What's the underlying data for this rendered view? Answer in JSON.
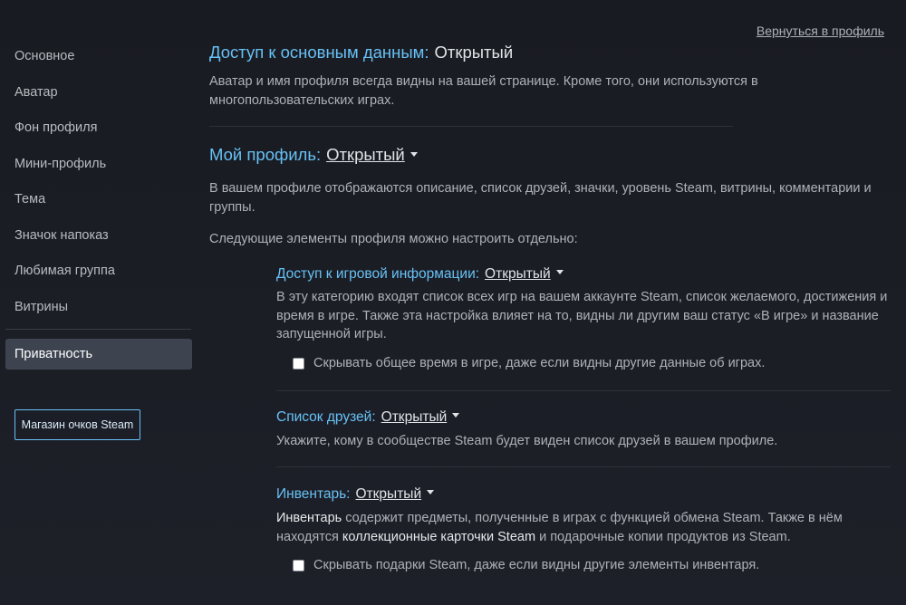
{
  "header": {
    "back_link": "Вернуться в профиль"
  },
  "sidebar": {
    "items": [
      {
        "label": "Основное"
      },
      {
        "label": "Аватар"
      },
      {
        "label": "Фон профиля"
      },
      {
        "label": "Мини-профиль"
      },
      {
        "label": "Тема"
      },
      {
        "label": "Значок напоказ"
      },
      {
        "label": "Любимая группа"
      },
      {
        "label": "Витрины"
      }
    ],
    "active_item": "Приватность",
    "shop_button": "Магазин очков Steam"
  },
  "main": {
    "basic": {
      "title": "Доступ к основным данным:",
      "value": "Открытый",
      "description": "Аватар и имя профиля всегда видны на вашей странице. Кроме того, они используются в многопользовательских играх."
    },
    "profile": {
      "title": "Мой профиль:",
      "value": "Открытый",
      "description": "В вашем профиле отображаются описание, список друзей, значки, уровень Steam, витрины, комментарии и группы.",
      "sub_intro": "Следующие элементы профиля можно настроить отдельно:"
    },
    "game_details": {
      "title": "Доступ к игровой информации:",
      "value": "Открытый",
      "description": "В эту категорию входят список всех игр на вашем аккаунте Steam, список желаемого, достижения и время в игре. Также эта настройка влияет на то, видны ли другим ваш статус «В игре» и название запущенной игры.",
      "checkbox_label": "Скрывать общее время в игре, даже если видны другие данные об играх."
    },
    "friends": {
      "title": "Список друзей:",
      "value": "Открытый",
      "description": "Укажите, кому в сообществе Steam будет виден список друзей в вашем профиле."
    },
    "inventory": {
      "title": "Инвентарь:",
      "value": "Открытый",
      "desc_part1": "Инвентарь",
      "desc_part2": " содержит предметы, полученные в играх с функцией обмена Steam. Также в нём находятся ",
      "desc_part3": "коллекционные карточки Steam",
      "desc_part4": " и подарочные копии продуктов из Steam.",
      "checkbox_label": "Скрывать подарки Steam, даже если видны другие элементы инвентаря."
    }
  }
}
